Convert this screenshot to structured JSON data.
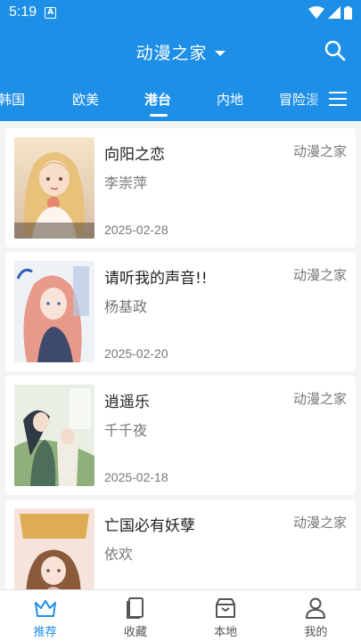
{
  "status_bar": {
    "time": "5:19",
    "notification_glyph": "A"
  },
  "app_bar": {
    "title": "动漫之家"
  },
  "tabs": [
    {
      "label": "韩国"
    },
    {
      "label": "欧美"
    },
    {
      "label": "港台"
    },
    {
      "label": "内地"
    },
    {
      "label": "冒险漫"
    }
  ],
  "active_tab": "港台",
  "comics": [
    {
      "name": "向阳之恋",
      "author": "李崇萍",
      "date": "2025-02-28",
      "source": "动漫之家"
    },
    {
      "name": "请听我的声音!!",
      "author": "杨基政",
      "date": "2025-02-20",
      "source": "动漫之家"
    },
    {
      "name": "逍遥乐",
      "author": "千千夜",
      "date": "2025-02-18",
      "source": "动漫之家"
    },
    {
      "name": "亡国必有妖孽",
      "author": "依欢",
      "date": "",
      "source": "动漫之家"
    }
  ],
  "bottom_nav": [
    {
      "label": "推荐",
      "icon": "crown-icon",
      "active": true
    },
    {
      "label": "收藏",
      "icon": "book-icon",
      "active": false
    },
    {
      "label": "本地",
      "icon": "storage-icon",
      "active": false
    },
    {
      "label": "我的",
      "icon": "person-icon",
      "active": false
    }
  ],
  "colors": {
    "primary": "#1e8fe6",
    "background": "#f4f4f4",
    "text": "#222222",
    "subtext": "#777777"
  }
}
